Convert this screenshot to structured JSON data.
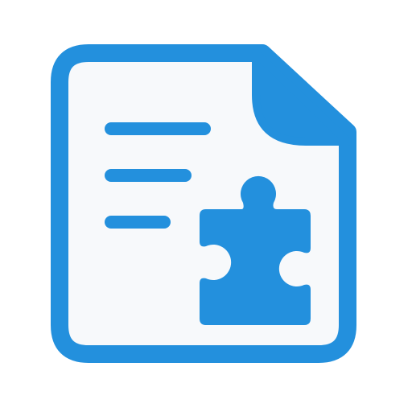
{
  "icon": {
    "name": "document-plugin-icon",
    "colors": {
      "stroke": "#2390dd",
      "fill_inner": "#f7f9fb",
      "background": "#ffffff"
    }
  }
}
